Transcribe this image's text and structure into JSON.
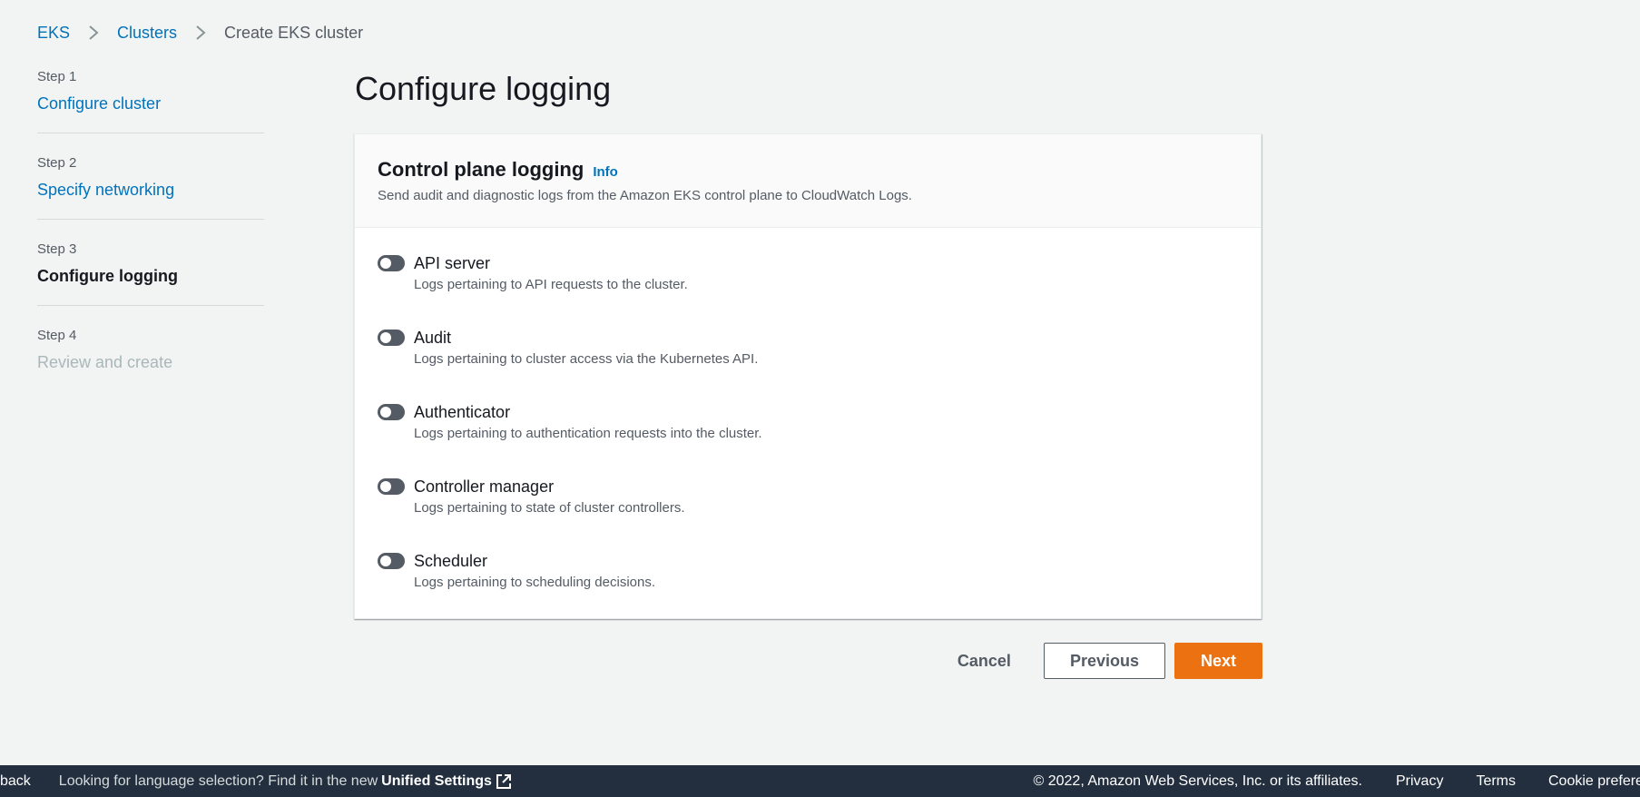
{
  "breadcrumb": {
    "items": [
      "EKS",
      "Clusters"
    ],
    "current": "Create EKS cluster"
  },
  "steps": [
    {
      "number": "Step 1",
      "title": "Configure cluster",
      "state": "link"
    },
    {
      "number": "Step 2",
      "title": "Specify networking",
      "state": "link"
    },
    {
      "number": "Step 3",
      "title": "Configure logging",
      "state": "current"
    },
    {
      "number": "Step 4",
      "title": "Review and create",
      "state": "disabled"
    }
  ],
  "page": {
    "title": "Configure logging"
  },
  "panel": {
    "title": "Control plane logging",
    "info": "Info",
    "description": "Send audit and diagnostic logs from the Amazon EKS control plane to CloudWatch Logs.",
    "toggles": [
      {
        "label": "API server",
        "description": "Logs pertaining to API requests to the cluster.",
        "enabled": false
      },
      {
        "label": "Audit",
        "description": "Logs pertaining to cluster access via the Kubernetes API.",
        "enabled": false
      },
      {
        "label": "Authenticator",
        "description": "Logs pertaining to authentication requests into the cluster.",
        "enabled": false
      },
      {
        "label": "Controller manager",
        "description": "Logs pertaining to state of cluster controllers.",
        "enabled": false
      },
      {
        "label": "Scheduler",
        "description": "Logs pertaining to scheduling decisions.",
        "enabled": false
      }
    ]
  },
  "actions": {
    "cancel": "Cancel",
    "previous": "Previous",
    "next": "Next"
  },
  "footer": {
    "feedback": "back",
    "language_prompt": "Looking for language selection? Find it in the new",
    "unified_settings": "Unified Settings",
    "copyright": "© 2022, Amazon Web Services, Inc. or its affiliates.",
    "privacy": "Privacy",
    "terms": "Terms",
    "cookie": "Cookie preferences"
  },
  "colors": {
    "link": "#0073bb",
    "primary": "#ec7211",
    "footer_bg": "#232f3e",
    "page_bg": "#f2f3f3",
    "toggle_off": "#545b64"
  },
  "icons": {
    "breadcrumb_separator": "chevron-right-icon",
    "external_link": "external-link-icon"
  }
}
